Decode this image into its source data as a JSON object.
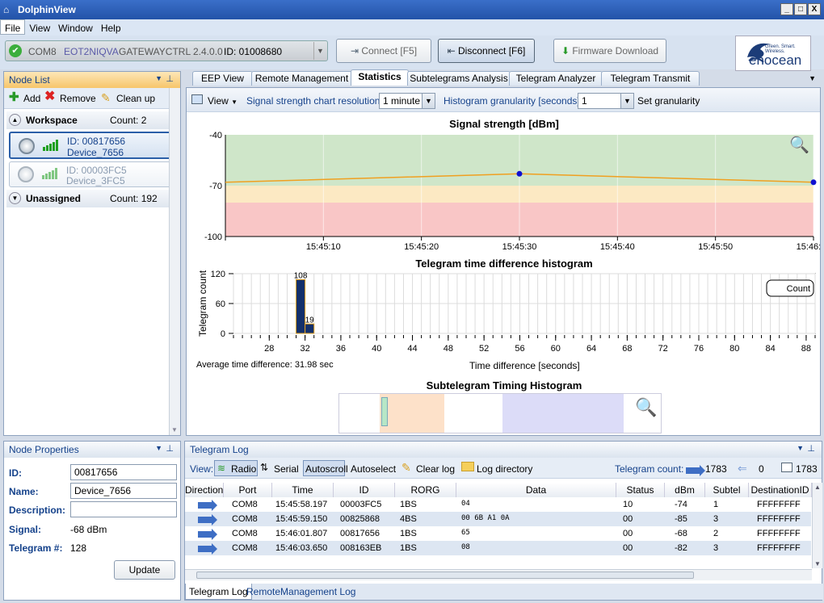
{
  "app": {
    "title": "DolphinView"
  },
  "window_buttons": {
    "minimize": "_",
    "maximize": "□",
    "close": "X"
  },
  "menu": [
    "File",
    "View",
    "Window",
    "Help"
  ],
  "toolbar": {
    "connection": {
      "port": "COM8",
      "device": "EOT2NIQVA",
      "gateway": "GATEWAYCTRL 2.4.0.0",
      "id": "ID: 01008680"
    },
    "connect": "Connect [F5]",
    "disconnect": "Disconnect [F6]",
    "firmware": "Firmware Download",
    "logo": {
      "tagline": "Green. Smart. Wireless.",
      "brand": "enocean"
    }
  },
  "node_list": {
    "title": "Node List",
    "actions": {
      "add": "Add",
      "remove": "Remove",
      "cleanup": "Clean up"
    },
    "workspace": {
      "label": "Workspace",
      "count": "Count: 2"
    },
    "nodes": [
      {
        "id": "ID: 00817656",
        "name": "Device_7656"
      },
      {
        "id": "ID: 00003FC5",
        "name": "Device_3FC5"
      }
    ],
    "unassigned": {
      "label": "Unassigned",
      "count": "Count: 192"
    }
  },
  "node_properties": {
    "title": "Node Properties",
    "id_label": "ID:",
    "id": "00817656",
    "name_label": "Name:",
    "name": "Device_7656",
    "desc_label": "Description:",
    "desc": "",
    "signal_label": "Signal:",
    "signal": "-68 dBm",
    "telegram_label": "Telegram #:",
    "telegram": "128",
    "update": "Update"
  },
  "tabs": [
    "EEP View",
    "Remote Management",
    "Statistics",
    "Subtelegrams Analysis",
    "Telegram Analyzer",
    "Telegram Transmit"
  ],
  "stats_bar": {
    "view": "View",
    "resolution_label": "Signal strength chart resolution:",
    "resolution": "1 minute",
    "granularity_label": "Histogram granularity [seconds]:",
    "granularity": "1",
    "set_label": "Set granularity"
  },
  "chart_data": [
    {
      "type": "line",
      "title": "Signal strength [dBm]",
      "x": [
        "15:45:00",
        "15:45:30",
        "15:46:05"
      ],
      "series": [
        {
          "values": [
            -68,
            -63,
            -68
          ]
        }
      ],
      "tick_labels_x": [
        "15:45:10",
        "15:45:20",
        "15:45:30",
        "15:45:40",
        "15:45:50",
        "15:46:00"
      ],
      "tick_labels_y": [
        "-40",
        "-70",
        "-100"
      ],
      "ylim": [
        -100,
        -40
      ],
      "bands": [
        {
          "from": -40,
          "to": -70,
          "color": "#cfe6c9"
        },
        {
          "from": -70,
          "to": -80,
          "color": "#fce9c3"
        },
        {
          "from": -80,
          "to": -100,
          "color": "#f9c6c6"
        }
      ],
      "line_color": "#f0a020",
      "point_color": "#1010d0"
    },
    {
      "type": "bar",
      "title": "Telegram time difference histogram",
      "xlabel": "Time difference [seconds]",
      "ylabel": "Telegram count",
      "categories": [
        31,
        32
      ],
      "values": [
        108,
        19
      ],
      "xlim": [
        24,
        89
      ],
      "ylim": [
        0,
        120
      ],
      "tick_labels_x": [
        "28",
        "32",
        "36",
        "40",
        "44",
        "48",
        "52",
        "56",
        "60",
        "64",
        "68",
        "72",
        "76",
        "80",
        "84",
        "88"
      ],
      "tick_labels_y": [
        "120",
        "60",
        "0"
      ],
      "legend": "Count",
      "average": "Average time difference: 31.98 sec",
      "bar_color": "#13306b",
      "bar_border": "#e0a020"
    }
  ],
  "subtelegram": {
    "title": "Subtelegram Timing Histogram"
  },
  "telegram_log": {
    "title": "Telegram Log",
    "view_label": "View:",
    "radio": "Radio",
    "serial": "Serial",
    "autoscroll": "Autoscroll",
    "autoselect": "Autoselect",
    "clear": "Clear log",
    "directory": "Log directory",
    "count_label": "Telegram count:",
    "count_in": "1783",
    "count_out": "0",
    "count_total": "1783",
    "columns": [
      "Direction",
      "Port",
      "Time",
      "ID",
      "RORG",
      "Data",
      "Status",
      "dBm",
      "Subtel",
      "DestinationID"
    ],
    "rows": [
      {
        "port": "COM8",
        "time": "15:45:58.197",
        "id": "00003FC5",
        "rorg": "1BS",
        "data": "04",
        "status": "10",
        "dbm": "-74",
        "subtel": "1",
        "dest": "FFFFFFFF"
      },
      {
        "port": "COM8",
        "time": "15:45:59.150",
        "id": "00825868",
        "rorg": "4BS",
        "data": "00 6B A1 0A",
        "status": "00",
        "dbm": "-85",
        "subtel": "3",
        "dest": "FFFFFFFF"
      },
      {
        "port": "COM8",
        "time": "15:46:01.807",
        "id": "00817656",
        "rorg": "1BS",
        "data": "65",
        "status": "00",
        "dbm": "-68",
        "subtel": "2",
        "dest": "FFFFFFFF"
      },
      {
        "port": "COM8",
        "time": "15:46:03.650",
        "id": "008163EB",
        "rorg": "1BS",
        "data": "08",
        "status": "00",
        "dbm": "-82",
        "subtel": "3",
        "dest": "FFFFFFFF"
      }
    ],
    "bottom_tabs": [
      "Telegram Log",
      "RemoteManagement Log"
    ]
  }
}
